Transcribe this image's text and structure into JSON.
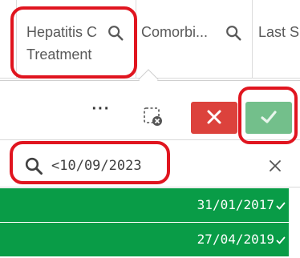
{
  "columns": [
    {
      "label": "Hepatitis C Treatment",
      "icon": "search-icon"
    },
    {
      "label": "Comorbi...",
      "icon": "search-icon"
    },
    {
      "label": "Last S"
    }
  ],
  "toolbar": {
    "more_label": "···",
    "clear_selections_icon": "clear-selections-icon",
    "cancel_icon": "close-x-icon",
    "confirm_icon": "checkmark-icon",
    "cancel_color": "#dc423c",
    "confirm_color": "#73bf8b"
  },
  "search": {
    "value": "<10/09/2023",
    "icon": "search-icon",
    "clear_icon": "close-icon"
  },
  "list_items": [
    {
      "value": "31/01/2017",
      "selected": true
    },
    {
      "value": "27/04/2019",
      "selected": true
    }
  ],
  "colors": {
    "selected": "#099c47",
    "highlight": "#e0151f"
  }
}
